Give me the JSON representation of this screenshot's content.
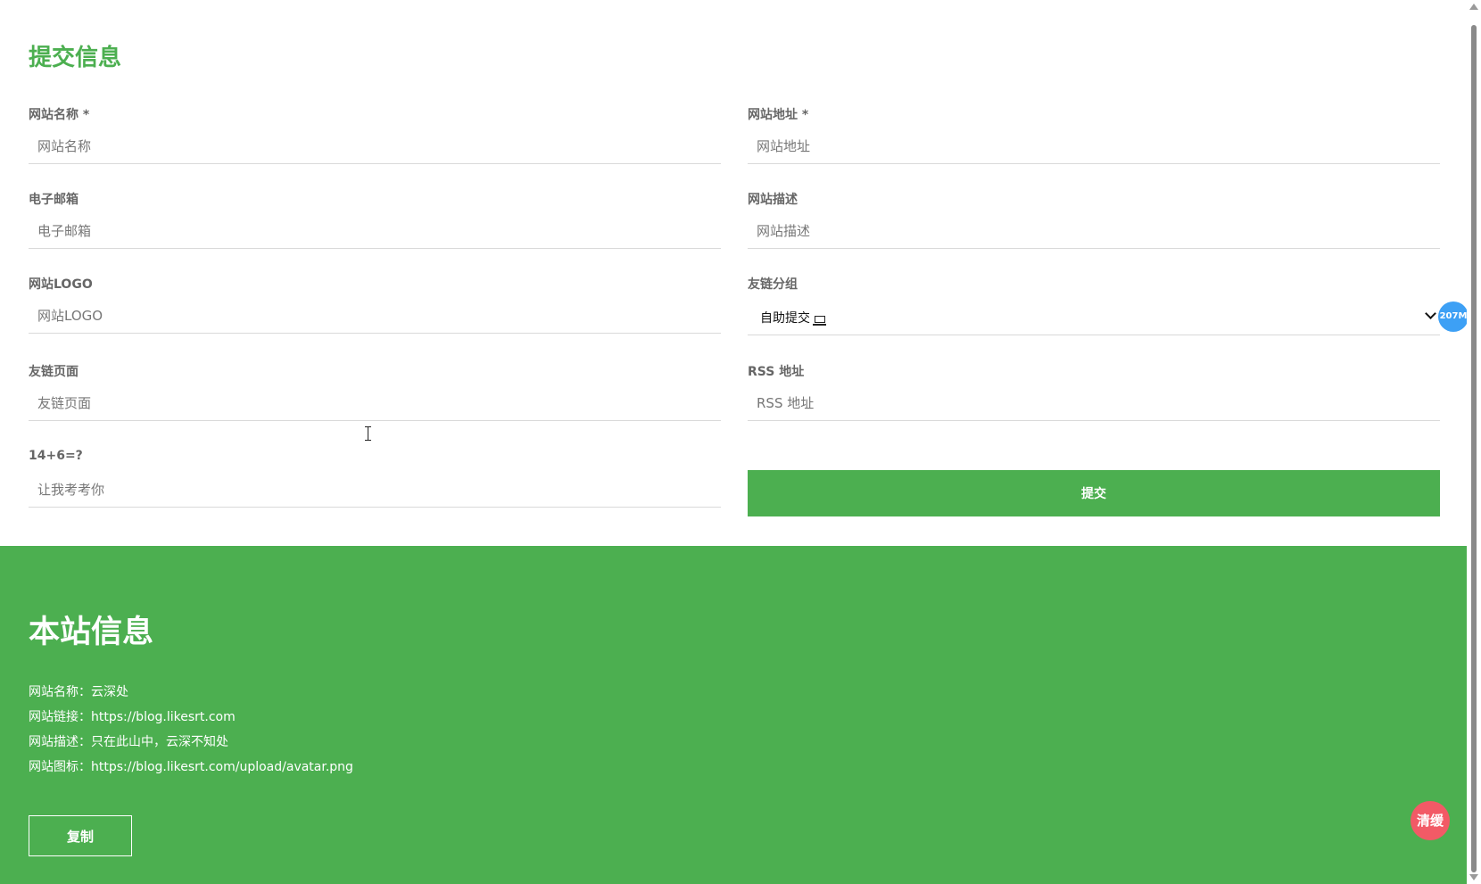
{
  "form": {
    "title": "提交信息",
    "left_fields": [
      {
        "label": "网站名称 *",
        "placeholder": "网站名称",
        "value": ""
      },
      {
        "label": "电子邮箱",
        "placeholder": "电子邮箱",
        "value": ""
      },
      {
        "label": "网站LOGO",
        "placeholder": "网站LOGO",
        "value": ""
      },
      {
        "label": "友链页面",
        "placeholder": "友链页面",
        "value": ""
      },
      {
        "label": "14+6=?",
        "placeholder": "让我考考你",
        "value": ""
      }
    ],
    "right_fields": [
      {
        "label": "网站地址 *",
        "placeholder": "网站地址",
        "value": ""
      },
      {
        "label": "网站描述",
        "placeholder": "网站描述",
        "value": ""
      },
      {
        "label": "友链分组",
        "selected": "自助提交"
      },
      {
        "label": "RSS 地址",
        "placeholder": "RSS 地址",
        "value": ""
      }
    ],
    "submit_label": "提交"
  },
  "info": {
    "title": "本站信息",
    "lines": [
      "网站名称：云深处",
      "网站链接：https://blog.likesrt.com",
      "网站描述：只在此山中，云深不知处",
      "网站图标：https://blog.likesrt.com/upload/avatar.png"
    ],
    "copy_label": "复制"
  },
  "widgets": {
    "memory_badge": "207M",
    "clear_cache": "清缓"
  },
  "colors": {
    "accent": "#4caf50",
    "memory_badge": "#3da0f5",
    "clear_cache": "#f25a66"
  }
}
